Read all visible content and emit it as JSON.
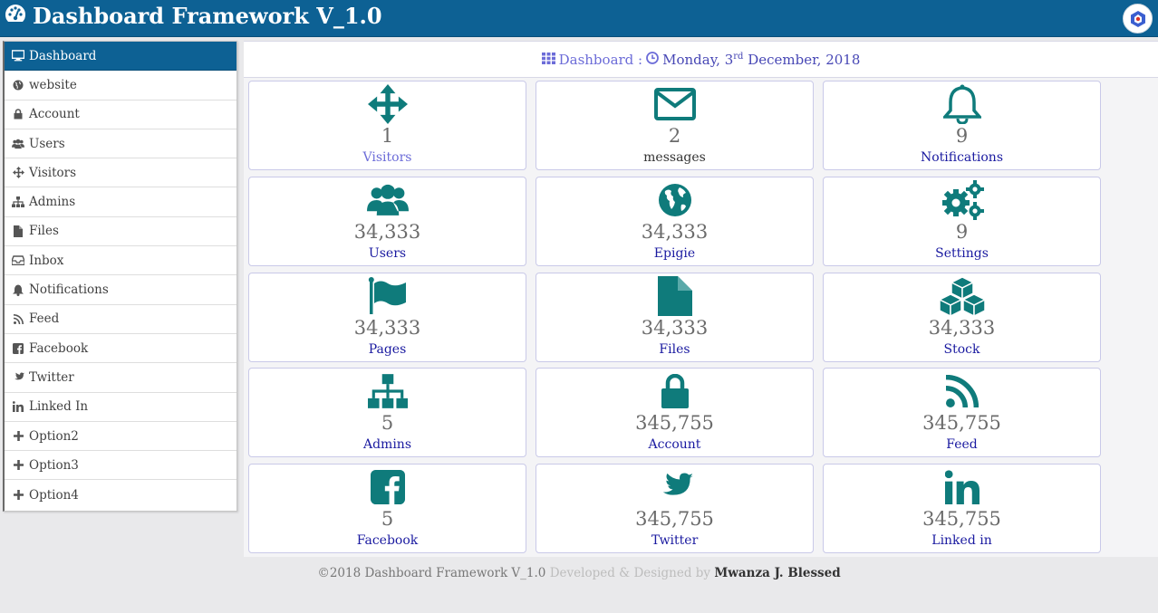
{
  "header": {
    "title": "Dashboard Framework V_1.0",
    "brand_icon": "dashboard-gauge-icon",
    "logo_icon": "app-logo-icon"
  },
  "sidebar": {
    "items": [
      {
        "label": "Dashboard",
        "icon": "desktop-icon"
      },
      {
        "label": "website",
        "icon": "globe-icon"
      },
      {
        "label": "Account",
        "icon": "lock-icon"
      },
      {
        "label": "Users",
        "icon": "users-icon"
      },
      {
        "label": "Visitors",
        "icon": "move-arrows-icon"
      },
      {
        "label": "Admins",
        "icon": "sitemap-icon"
      },
      {
        "label": "Files",
        "icon": "file-icon"
      },
      {
        "label": "Inbox",
        "icon": "inbox-icon"
      },
      {
        "label": "Notifications",
        "icon": "bell-icon"
      },
      {
        "label": "Feed",
        "icon": "rss-icon"
      },
      {
        "label": "Facebook",
        "icon": "facebook-icon"
      },
      {
        "label": "Twitter",
        "icon": "twitter-icon"
      },
      {
        "label": "Linked In",
        "icon": "linkedin-icon"
      },
      {
        "label": "Option2",
        "icon": "plus-icon"
      },
      {
        "label": "Option3",
        "icon": "plus-icon"
      },
      {
        "label": "Option4",
        "icon": "plus-icon"
      }
    ]
  },
  "datebar": {
    "prefix": "Dashboard :",
    "day_text": "Monday, 3",
    "suffix": "rd",
    "month_year": "December, 2018"
  },
  "cards": [
    {
      "icon": "move-arrows-icon",
      "value": "1",
      "label": "Visitors",
      "label_color": "#6c6cd8"
    },
    {
      "icon": "envelope-icon",
      "value": "2",
      "label": "messages",
      "label_color": "#333333"
    },
    {
      "icon": "bell-icon",
      "value": "9",
      "label": "Notifications",
      "label_color": "#1a1aa0"
    },
    {
      "icon": "users-icon",
      "value": "34,333",
      "label": "Users",
      "label_color": "#1a1aa0"
    },
    {
      "icon": "globe-icon",
      "value": "34,333",
      "label": "Epigie",
      "label_color": "#1a1aa0"
    },
    {
      "icon": "gears-icon",
      "value": "9",
      "label": "Settings",
      "label_color": "#1a1aa0"
    },
    {
      "icon": "flag-icon",
      "value": "34,333",
      "label": "Pages",
      "label_color": "#1a1aa0"
    },
    {
      "icon": "file-icon",
      "value": "34,333",
      "label": "Files",
      "label_color": "#1a1aa0"
    },
    {
      "icon": "cubes-icon",
      "value": "34,333",
      "label": "Stock",
      "label_color": "#1a1aa0"
    },
    {
      "icon": "sitemap-icon",
      "value": "5",
      "label": "Admins",
      "label_color": "#1a1aa0"
    },
    {
      "icon": "lock-icon",
      "value": "345,755",
      "label": "Account",
      "label_color": "#1a1aa0"
    },
    {
      "icon": "rss-icon",
      "value": "345,755",
      "label": "Feed",
      "label_color": "#1a1aa0"
    },
    {
      "icon": "facebook-icon",
      "value": "5",
      "label": "Facebook",
      "label_color": "#1a1aa0"
    },
    {
      "icon": "twitter-icon",
      "value": "345,755",
      "label": "Twitter",
      "label_color": "#1a1aa0"
    },
    {
      "icon": "linkedin-icon",
      "value": "345,755",
      "label": "Linked in",
      "label_color": "#1a1aa0"
    }
  ],
  "footer": {
    "copyright": "©2018 Dashboard Framework V_1.0",
    "credit_text": "Developed & Designed by",
    "author": "Mwanza J. Blessed"
  },
  "colors": {
    "header_bg": "#0d6194",
    "icon_teal": "#0f7b7b",
    "date_text": "#6c6cd8",
    "label_blue": "#1a1aa0"
  }
}
